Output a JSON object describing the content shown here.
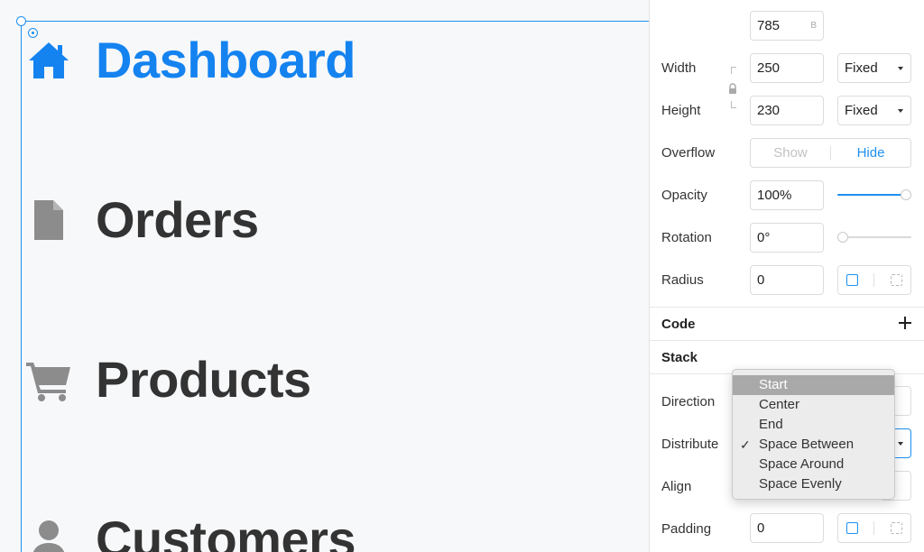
{
  "canvas": {
    "nav": [
      {
        "label": "Dashboard",
        "icon": "home-icon",
        "active": true
      },
      {
        "label": "Orders",
        "icon": "document-icon",
        "active": false
      },
      {
        "label": "Products",
        "icon": "cart-icon",
        "active": false
      },
      {
        "label": "Customers",
        "icon": "user-icon",
        "active": false
      }
    ]
  },
  "inspector": {
    "top_value": "785",
    "top_unit": "B",
    "width": {
      "label": "Width",
      "value": "250",
      "mode": "Fixed"
    },
    "height": {
      "label": "Height",
      "value": "230",
      "mode": "Fixed"
    },
    "overflow": {
      "label": "Overflow",
      "options": [
        "Show",
        "Hide"
      ],
      "selected": "Hide"
    },
    "opacity": {
      "label": "Opacity",
      "value": "100%",
      "level": 1.0
    },
    "rotation": {
      "label": "Rotation",
      "value": "0°",
      "level": 0.0
    },
    "radius": {
      "label": "Radius",
      "value": "0"
    },
    "sections": {
      "code": "Code",
      "stack": "Stack"
    },
    "direction": {
      "label": "Direction"
    },
    "distribute": {
      "label": "Distribute"
    },
    "align": {
      "label": "Align"
    },
    "padding": {
      "label": "Padding",
      "value": "0"
    }
  },
  "menu": {
    "items": [
      "Start",
      "Center",
      "End",
      "Space Between",
      "Space Around",
      "Space Evenly"
    ],
    "highlighted": "Start",
    "checked": "Space Between",
    "check_glyph": "✓"
  },
  "colors": {
    "accent": "#1e90f0",
    "active_nav": "#1483f0",
    "nav_text": "#333333",
    "icon_gray": "#8c8c8c"
  }
}
